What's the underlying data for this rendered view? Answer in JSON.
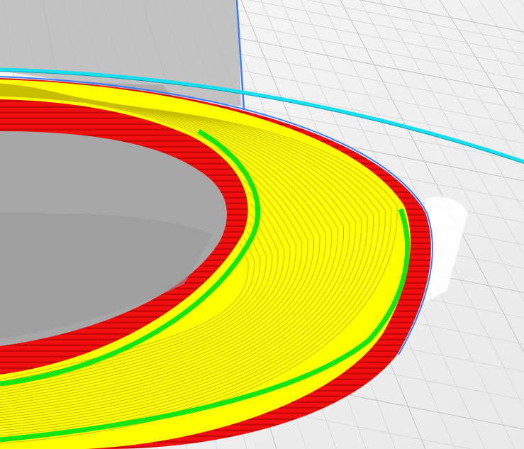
{
  "viewer": {
    "view_mode": "layer-preview",
    "background_color": "#f2f2f2",
    "grid_color": "#d9d9d9",
    "grid_major_color": "#c4c4c4",
    "build_volume_edge_color": "#3d7bff",
    "skirt_color": "#18dff0",
    "outer_wall_color": "#ee1111",
    "inner_wall_color": "#14e614",
    "infill_color": "#ffff00",
    "shadow_color": "#9a9a9a"
  }
}
